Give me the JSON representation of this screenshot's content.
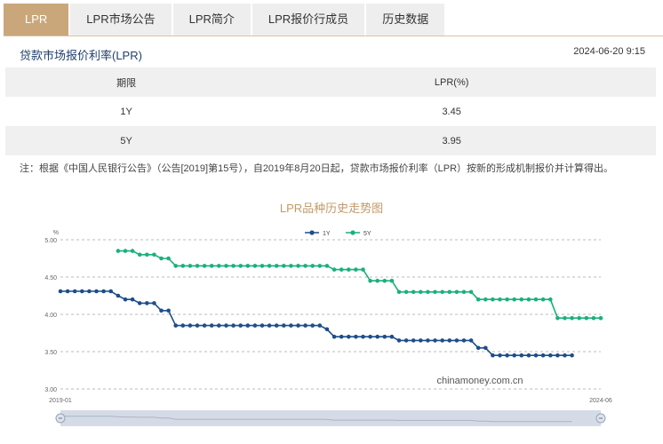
{
  "tabs": [
    {
      "label": "LPR",
      "active": true
    },
    {
      "label": "LPR市场公告",
      "active": false
    },
    {
      "label": "LPR简介",
      "active": false
    },
    {
      "label": "LPR报价行成员",
      "active": false
    },
    {
      "label": "历史数据",
      "active": false
    }
  ],
  "header": {
    "title": "贷款市场报价利率(LPR)",
    "timestamp": "2024-06-20 9:15"
  },
  "table": {
    "headers": [
      "期限",
      "LPR(%)"
    ],
    "rows": [
      {
        "term": "1Y",
        "rate": "3.45"
      },
      {
        "term": "5Y",
        "rate": "3.95"
      }
    ]
  },
  "note": "注：根据《中国人民银行公告》（公告[2019]第15号），自2019年8月20日起，贷款市场报价利率（LPR）按新的形成机制报价并计算得出。",
  "chart_title": "LPR品种历史走势图",
  "watermark": "chinamoney.com.cn",
  "colors": {
    "accent": "#c9a77a",
    "series_1y": "#1c4e8a",
    "series_5y": "#1ab07e"
  },
  "chart_data": {
    "type": "line",
    "y_unit": "%",
    "ylim": [
      3.0,
      5.0
    ],
    "yticks": [
      "3.00",
      "3.50",
      "4.00",
      "4.50",
      "5.00"
    ],
    "x_start_label": "2019-01",
    "x_end_label": "2024-06",
    "legend_position": "top-center",
    "grid": true,
    "series": [
      {
        "name": "1Y",
        "color": "#1c4e8a",
        "values": [
          4.31,
          4.31,
          4.31,
          4.31,
          4.31,
          4.31,
          4.31,
          4.31,
          4.25,
          4.2,
          4.2,
          4.15,
          4.15,
          4.15,
          4.05,
          4.05,
          3.85,
          3.85,
          3.85,
          3.85,
          3.85,
          3.85,
          3.85,
          3.85,
          3.85,
          3.85,
          3.85,
          3.85,
          3.85,
          3.85,
          3.85,
          3.85,
          3.85,
          3.85,
          3.85,
          3.85,
          3.85,
          3.8,
          3.7,
          3.7,
          3.7,
          3.7,
          3.7,
          3.7,
          3.7,
          3.7,
          3.7,
          3.65,
          3.65,
          3.65,
          3.65,
          3.65,
          3.65,
          3.65,
          3.65,
          3.65,
          3.65,
          3.65,
          3.55,
          3.55,
          3.45,
          3.45,
          3.45,
          3.45,
          3.45,
          3.45,
          3.45,
          3.45,
          3.45,
          3.45,
          3.45,
          3.45
        ]
      },
      {
        "name": "5Y",
        "color": "#1ab07e",
        "values": [
          null,
          null,
          null,
          null,
          null,
          null,
          null,
          null,
          4.85,
          4.85,
          4.85,
          4.8,
          4.8,
          4.8,
          4.75,
          4.75,
          4.65,
          4.65,
          4.65,
          4.65,
          4.65,
          4.65,
          4.65,
          4.65,
          4.65,
          4.65,
          4.65,
          4.65,
          4.65,
          4.65,
          4.65,
          4.65,
          4.65,
          4.65,
          4.65,
          4.65,
          4.65,
          4.65,
          4.6,
          4.6,
          4.6,
          4.6,
          4.6,
          4.45,
          4.45,
          4.45,
          4.45,
          4.3,
          4.3,
          4.3,
          4.3,
          4.3,
          4.3,
          4.3,
          4.3,
          4.3,
          4.3,
          4.3,
          4.2,
          4.2,
          4.2,
          4.2,
          4.2,
          4.2,
          4.2,
          4.2,
          4.2,
          4.2,
          4.2,
          3.95,
          3.95,
          3.95,
          3.95,
          3.95,
          3.95,
          3.95
        ]
      }
    ]
  }
}
